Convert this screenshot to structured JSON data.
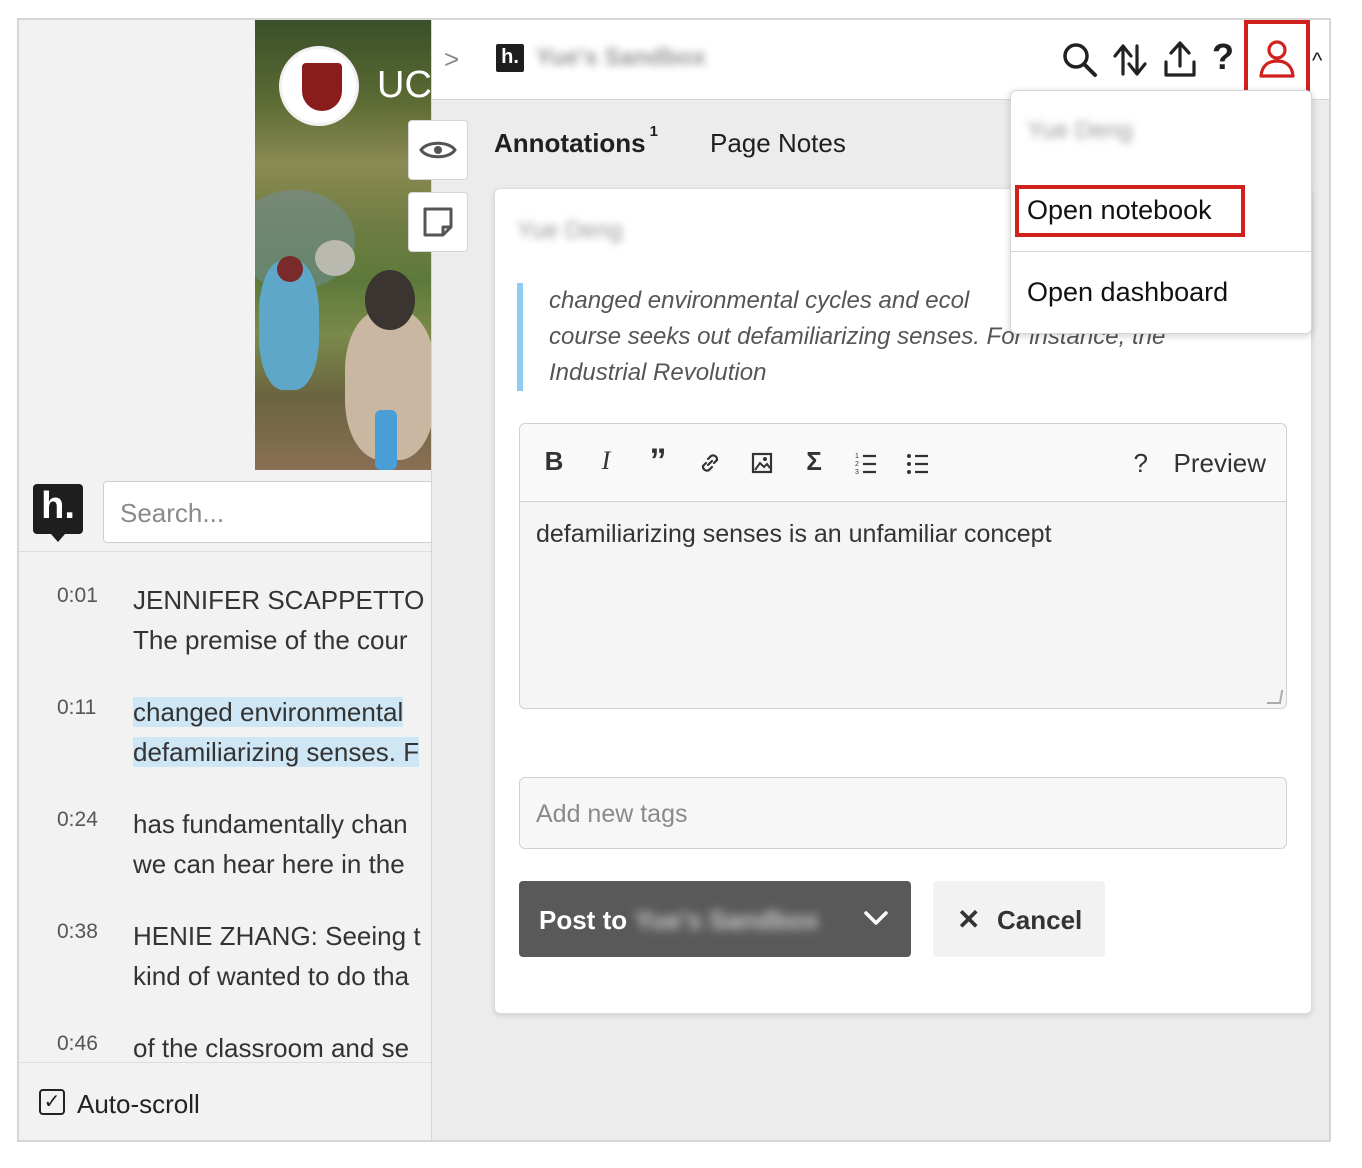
{
  "video": {
    "logo_text": "UC",
    "search_placeholder": "Search...",
    "transcript": [
      {
        "time": "0:01",
        "line1": "JENNIFER SCAPPETTO",
        "line2": "The premise of the cour",
        "highlight": false
      },
      {
        "time": "0:11",
        "line1": "changed environmental",
        "line2": "defamiliarizing senses. F",
        "highlight": true
      },
      {
        "time": "0:24",
        "line1": "has fundamentally chan",
        "line2": "we can hear here in the",
        "highlight": false
      },
      {
        "time": "0:38",
        "line1": "HENIE ZHANG: Seeing t",
        "line2": "kind of wanted to do tha",
        "highlight": false
      },
      {
        "time": "0:46",
        "line1": "of the classroom and se",
        "line2": "",
        "highlight": false
      }
    ],
    "autoscroll_label": "Auto-scroll",
    "autoscroll_checked": true
  },
  "sidebar": {
    "collapse_icon": "chevron-right-icon",
    "logo_letter": "h.",
    "group_name": "Yue's Sandbox",
    "toolbar_icons": [
      "search-icon",
      "sort-icon",
      "share-icon",
      "help-icon",
      "user-icon",
      "chevron-up-icon"
    ],
    "tabs": {
      "annotations_label": "Annotations",
      "annotations_count": "1",
      "page_notes_label": "Page Notes"
    },
    "card": {
      "author": "Yue Deng",
      "quote": [
        "changed environmental cycles and ecol",
        "course seeks out defamiliarizing senses. For instance, the",
        "Industrial Revolution"
      ],
      "toolbar_buttons": [
        "B",
        "I",
        "”",
        "link-icon",
        "image-icon",
        "Σ",
        "numbered-list-icon",
        "bullet-list-icon"
      ],
      "help_label": "?",
      "preview_label": "Preview",
      "note_text": "defamiliarizing senses is an unfamiliar concept",
      "tags_placeholder": "Add new tags",
      "post_label": "Post to",
      "post_group": "Yue's Sandbox",
      "cancel_label": "Cancel"
    }
  },
  "user_menu": {
    "user_name": "Yue Deng",
    "open_notebook": "Open notebook",
    "open_dashboard": "Open dashboard"
  },
  "colors": {
    "highlight_red": "#d0211d",
    "quote_bar": "#8ecdf0",
    "transcript_highlight": "#cfe7f5",
    "post_button": "#595959"
  }
}
